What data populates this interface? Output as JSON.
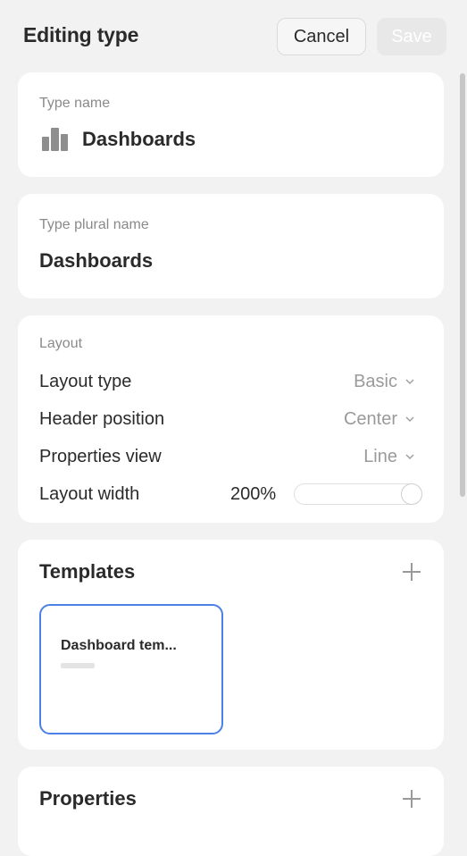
{
  "header": {
    "title": "Editing type",
    "cancel_label": "Cancel",
    "save_label": "Save"
  },
  "type_name": {
    "label": "Type name",
    "icon": "bar-chart-icon",
    "value": "Dashboards"
  },
  "type_plural_name": {
    "label": "Type plural name",
    "value": "Dashboards"
  },
  "layout": {
    "section_label": "Layout",
    "rows": [
      {
        "label": "Layout type",
        "value": "Basic"
      },
      {
        "label": "Header position",
        "value": "Center"
      },
      {
        "label": "Properties view",
        "value": "Line"
      }
    ],
    "width": {
      "label": "Layout width",
      "value": "200%",
      "slider_fraction": 1.0
    }
  },
  "templates": {
    "title": "Templates",
    "items": [
      {
        "name": "Dashboard tem..."
      }
    ]
  },
  "properties": {
    "title": "Properties"
  },
  "colors": {
    "accent": "#4a80e8",
    "background": "#f2f2f2",
    "card": "#ffffff"
  }
}
